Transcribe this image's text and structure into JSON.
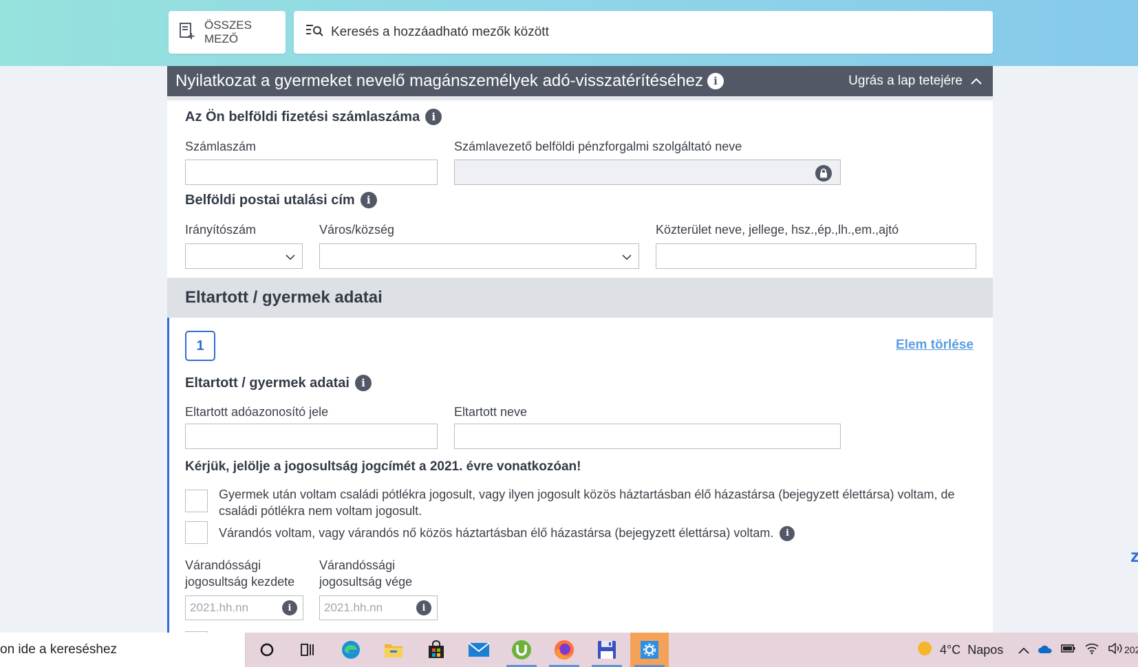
{
  "toolbar": {
    "all_fields_label": "ÖSSZES MEZŐ",
    "search_placeholder": "Keresés a hozzáadható mezők között"
  },
  "section": {
    "title": "Nyilatkozat a gyermeket nevelő magánszemélyek adó-visszatérítéséhez",
    "jump_label": "Ugrás a lap tetejére"
  },
  "bank": {
    "heading": "Az Ön belföldi fizetési számlaszáma",
    "account_label": "Számlaszám",
    "account_value": "",
    "provider_label": "Számlavezető belföldi pénzforgalmi szolgáltató neve",
    "provider_value": ""
  },
  "postal": {
    "heading": "Belföldi postai utalási cím",
    "zip_label": "Irányítószám",
    "city_label": "Város/község",
    "street_label": "Közterület neve, jellege, hsz.,ép.,lh.,em.,ajtó",
    "zip_value": "",
    "city_value": "",
    "street_value": ""
  },
  "dependents": {
    "band_title": "Eltartott / gyermek adatai",
    "item_number": "1",
    "delete_label": "Elem törlése",
    "sub_heading": "Eltartott / gyermek adatai",
    "tax_id_label": "Eltartott adóazonosító jele",
    "name_label": "Eltartott neve",
    "tax_id_value": "",
    "name_value": "",
    "entitlement_heading": "Kérjük, jelölje a jogosultság jogcímét a 2021. évre vonatkozóan!",
    "checkbox1_text": "Gyermek után voltam családi pótlékra jogosult, vagy ilyen jogosult közös háztartásban élő házastársa (bejegyzett élettársa) voltam, de családi pótlékra nem voltam jogosult.",
    "checkbox2_text": "Várandós voltam, vagy várandós nő közös háztartásban élő házastársa (bejegyzett élettársa) voltam.",
    "checkbox1_checked": false,
    "checkbox2_checked": false,
    "pregnancy_start_label": "Várandóssági jogosultság kezdete",
    "pregnancy_end_label": "Várandóssági jogosultság vége",
    "date_placeholder": "2021.hh.nn"
  },
  "taskbar": {
    "search_text": "on ide a kereséshez",
    "weather_temp": "4°C",
    "weather_text": "Napos",
    "clock_fragment": "202"
  },
  "colors": {
    "accent": "#2f6dd3",
    "section_header": "#525866",
    "link": "#5a9ee0"
  }
}
